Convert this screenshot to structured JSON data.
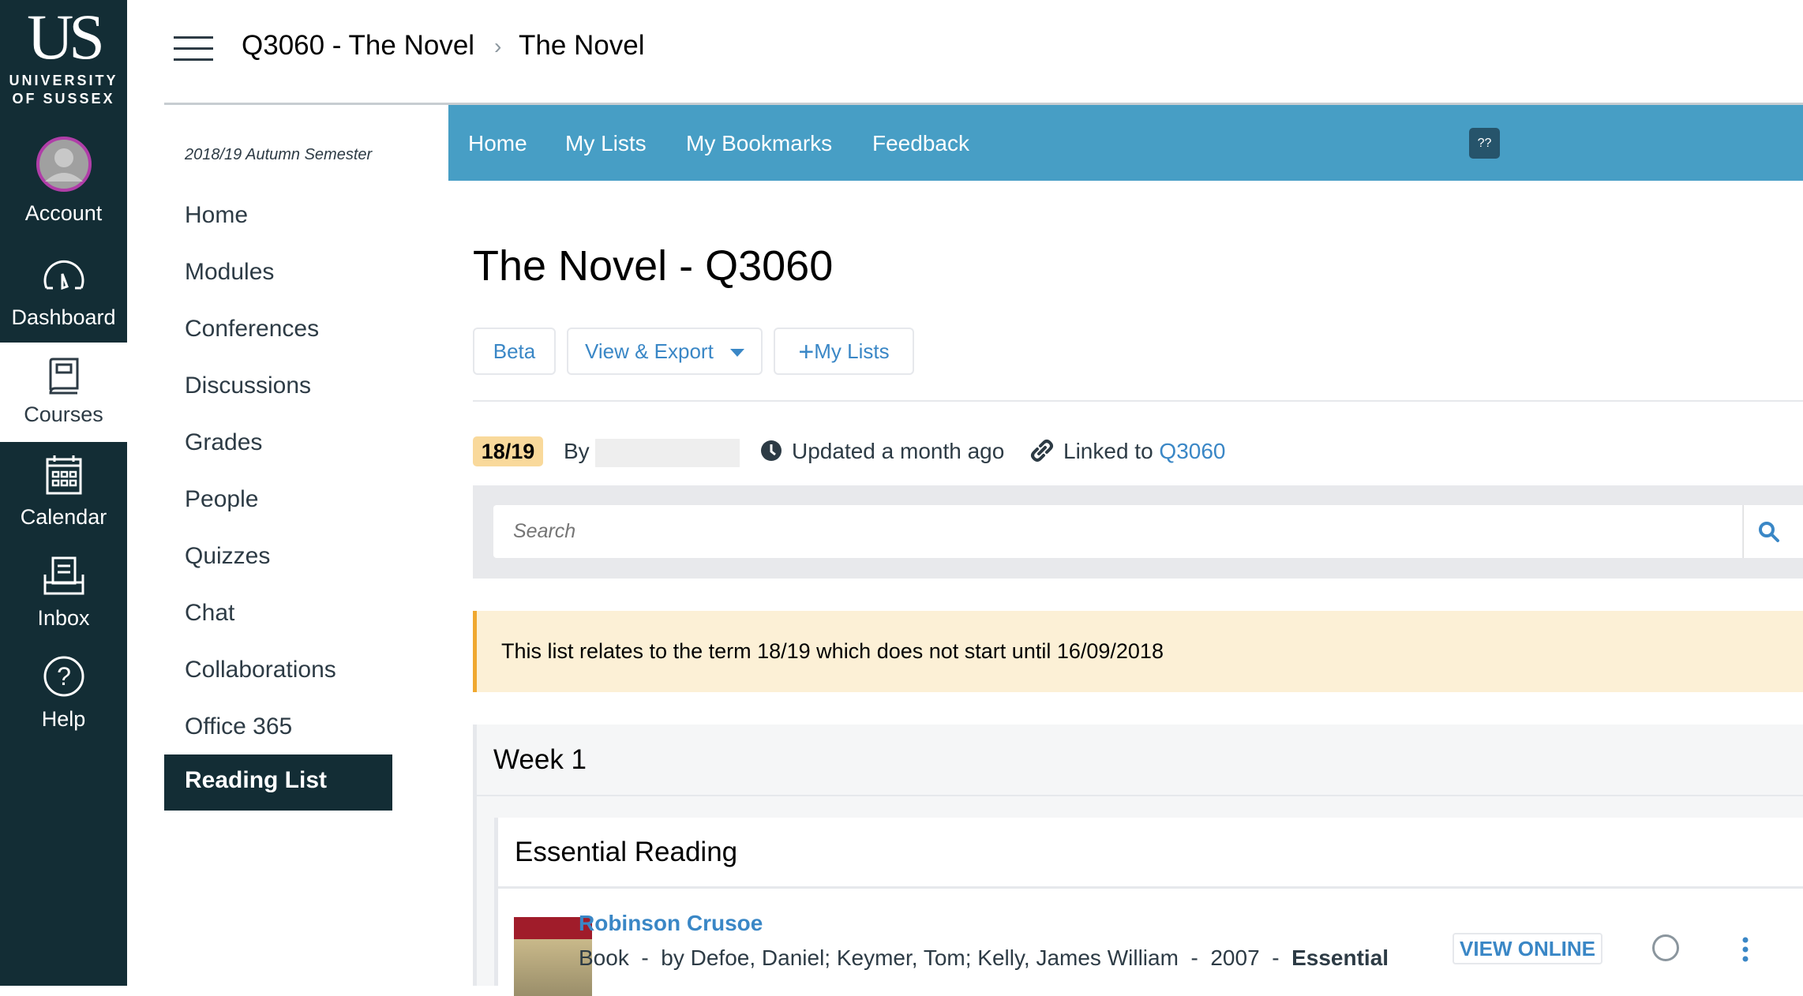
{
  "brand": {
    "logo_mark": "US",
    "line1": "UNIVERSITY",
    "line2": "OF SUSSEX"
  },
  "global_nav": [
    {
      "label": "Account",
      "icon": "avatar-icon"
    },
    {
      "label": "Dashboard",
      "icon": "dashboard-icon"
    },
    {
      "label": "Courses",
      "icon": "courses-icon",
      "active": true
    },
    {
      "label": "Calendar",
      "icon": "calendar-icon"
    },
    {
      "label": "Inbox",
      "icon": "inbox-icon"
    },
    {
      "label": "Help",
      "icon": "help-icon"
    }
  ],
  "header": {
    "breadcrumb": [
      "Q3060 - The Novel",
      "The Novel"
    ],
    "separator": "›"
  },
  "course_nav": {
    "term": "2018/19 Autumn Semester",
    "items": [
      "Home",
      "Modules",
      "Conferences",
      "Discussions",
      "Grades",
      "People",
      "Quizzes",
      "Chat",
      "Collaborations",
      "Office 365",
      "Reading List"
    ],
    "active": "Reading List"
  },
  "reading_list": {
    "topnav": [
      "Home",
      "My Lists",
      "My Bookmarks",
      "Feedback"
    ],
    "help_button": "??",
    "title": "The Novel - Q3060",
    "buttons": {
      "beta": "Beta",
      "view_export": "View & Export",
      "my_lists": "My Lists"
    },
    "meta": {
      "term_badge": "18/19",
      "by": "By",
      "updated": "Updated a month ago",
      "linked_prefix": "Linked to",
      "linked_code": "Q3060"
    },
    "search": {
      "placeholder": "Search"
    },
    "alert": "This list relates to the term 18/19 which does not start until 16/09/2018",
    "section": "Week 1",
    "subsection": "Essential Reading",
    "items": [
      {
        "title": "Robinson Crusoe",
        "type": "Book",
        "authors": "by Defoe, Daniel; Keymer, Tom; Kelly, James William",
        "year": "2007",
        "importance": "Essential",
        "action": "VIEW ONLINE"
      }
    ]
  },
  "colors": {
    "nav": "#132d35",
    "bar": "#479ec5",
    "link": "#3a87c6",
    "alert_bg": "#fcf0d6",
    "alert_border": "#f0a830",
    "badge": "#f9d99b"
  }
}
